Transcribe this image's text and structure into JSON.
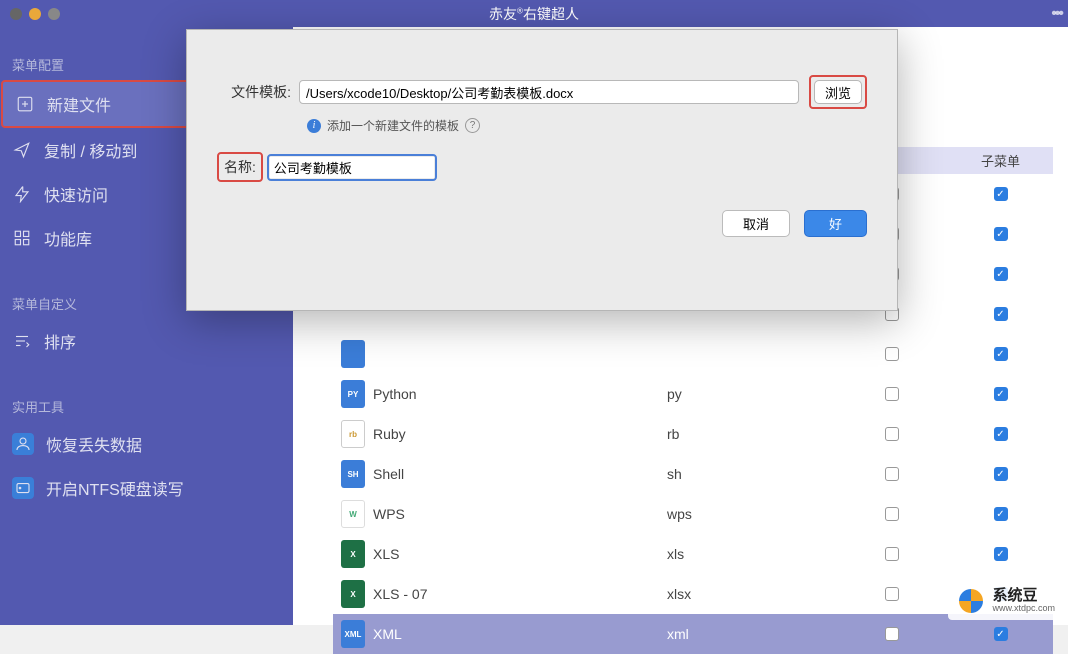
{
  "titlebar": {
    "app_name_prefix": "赤友",
    "app_name_reg": "®",
    "app_name_suffix": "右键超人"
  },
  "sidebar": {
    "section_menu": "菜单配置",
    "section_custom": "菜单自定义",
    "section_tools": "实用工具",
    "items": {
      "new_file": "新建文件",
      "copy_move": "复制 / 移动到",
      "quick_access": "快速访问",
      "function_lib": "功能库",
      "sort": "排序",
      "recover": "恢复丢失数据",
      "ntfs": "开启NTFS硬盘读写"
    }
  },
  "modal": {
    "label_template": "文件模板:",
    "template_path": "/Users/xcode10/Desktop/公司考勤表模板.docx",
    "browse": "浏览",
    "hint": "添加一个新建文件的模板",
    "label_name": "名称:",
    "name_value": "公司考勤模板",
    "cancel": "取消",
    "ok": "好"
  },
  "table": {
    "header": {
      "submenu": "子菜单"
    },
    "rows": [
      {
        "name": "Python",
        "ext": "py",
        "cb1": false,
        "cb2": true,
        "iconClass": "blue",
        "iconText": "PY"
      },
      {
        "name": "Ruby",
        "ext": "rb",
        "cb1": false,
        "cb2": true,
        "iconClass": "rb",
        "iconText": "rb"
      },
      {
        "name": "Shell",
        "ext": "sh",
        "cb1": false,
        "cb2": true,
        "iconClass": "blue",
        "iconText": "SH"
      },
      {
        "name": "WPS",
        "ext": "wps",
        "cb1": false,
        "cb2": true,
        "iconClass": "wps",
        "iconText": "W"
      },
      {
        "name": "XLS",
        "ext": "xls",
        "cb1": false,
        "cb2": true,
        "iconClass": "green",
        "iconText": "X"
      },
      {
        "name": "XLS - 07",
        "ext": "xlsx",
        "cb1": false,
        "cb2": true,
        "iconClass": "green",
        "iconText": "X"
      },
      {
        "name": "XML",
        "ext": "xml",
        "cb1": false,
        "cb2": true,
        "iconClass": "blue",
        "iconText": "XML",
        "selected": true
      }
    ],
    "hidden_rows_above": [
      {
        "cb2": true
      },
      {
        "cb2": true
      },
      {
        "cb2": true
      },
      {
        "cb2": true
      }
    ]
  },
  "watermark": {
    "name": "系统豆",
    "url": "www.xtdpc.com"
  }
}
